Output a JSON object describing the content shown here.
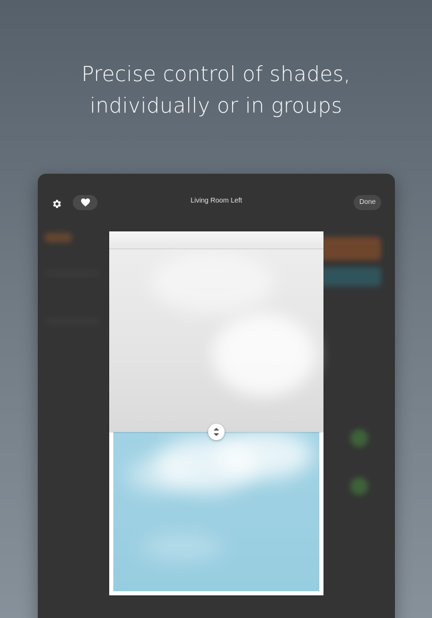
{
  "headline": {
    "line1": "Precise control of shades,",
    "line2": "individually or in groups"
  },
  "modal": {
    "title": "Living Room Left",
    "done_label": "Done",
    "settings_icon": "gear-icon",
    "favorite_icon": "heart-icon"
  },
  "shade": {
    "position_fraction": 0.55,
    "handle_icon": "up-down-arrows-icon"
  },
  "colors": {
    "background_top": "#55606b",
    "device": "#343434",
    "sky": "#a2d3e4",
    "shade_fabric": "#e4e4e4"
  }
}
